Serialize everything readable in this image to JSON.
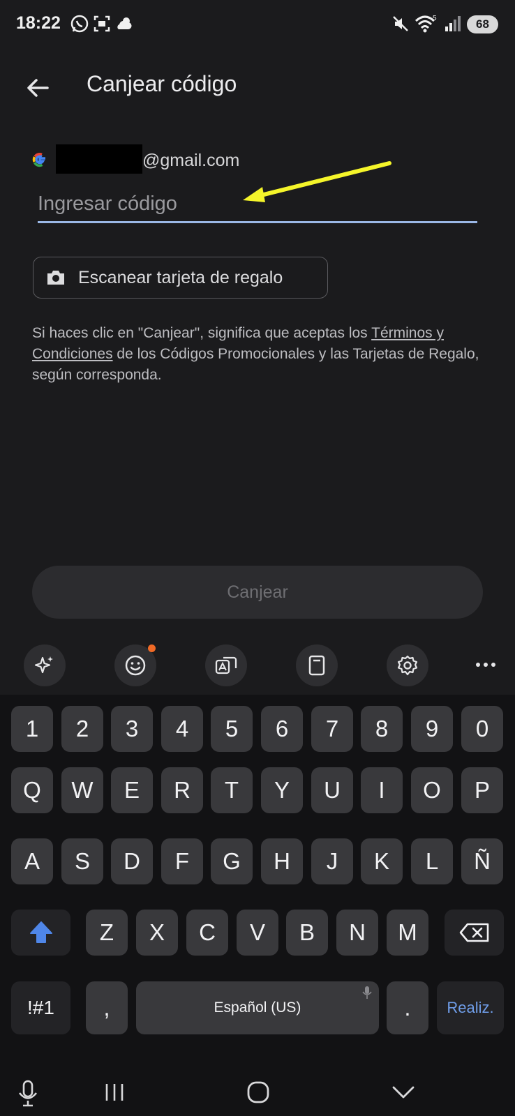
{
  "status_bar": {
    "time": "18:22",
    "battery": "68",
    "wifi_label": "5",
    "icons": [
      "whatsapp-icon",
      "screen-capture-icon",
      "weather-icon",
      "mute-icon",
      "wifi-icon",
      "signal-icon",
      "battery-icon"
    ]
  },
  "app_bar": {
    "title": "Canjear código",
    "back_icon": "arrow-back-icon"
  },
  "account": {
    "email_suffix": "@gmail.com",
    "provider_icon": "google-icon"
  },
  "code_input": {
    "placeholder": "Ingresar código",
    "value": ""
  },
  "scan_button": {
    "label": "Escanear tarjeta de regalo",
    "icon": "camera-icon"
  },
  "legal": {
    "before": "Si haces clic en \"Canjear\", significa que aceptas los ",
    "link": "Términos y Condiciones",
    "after": " de los Códigos Promocionales y las Tarjetas de Regalo, según corresponda."
  },
  "redeem_button": {
    "label": "Canjear"
  },
  "keyboard": {
    "toolbar": [
      "ai-sparkle-icon",
      "emoji-icon",
      "translate-icon",
      "clipboard-icon",
      "settings-icon",
      "more-icon"
    ],
    "row_numbers": [
      "1",
      "2",
      "3",
      "4",
      "5",
      "6",
      "7",
      "8",
      "9",
      "0"
    ],
    "row_q": [
      "Q",
      "W",
      "E",
      "R",
      "T",
      "Y",
      "U",
      "I",
      "O",
      "P"
    ],
    "row_a": [
      "A",
      "S",
      "D",
      "F",
      "G",
      "H",
      "J",
      "K",
      "L",
      "Ñ"
    ],
    "row_z": [
      "Z",
      "X",
      "C",
      "V",
      "B",
      "N",
      "M"
    ],
    "symbols_key": "!#1",
    "comma_key": ",",
    "space_label": "Español (US)",
    "period_key": ".",
    "done_key": "Realiz."
  },
  "nav_bar": [
    "microphone-icon",
    "recents-icon",
    "home-icon",
    "back-chevron-icon"
  ],
  "colors": {
    "background": "#1b1b1d",
    "accent_underline": "#9bb8e6",
    "annotation_arrow": "#f5f52a",
    "shift_active": "#4f86e8",
    "done_text": "#6f9de8"
  }
}
